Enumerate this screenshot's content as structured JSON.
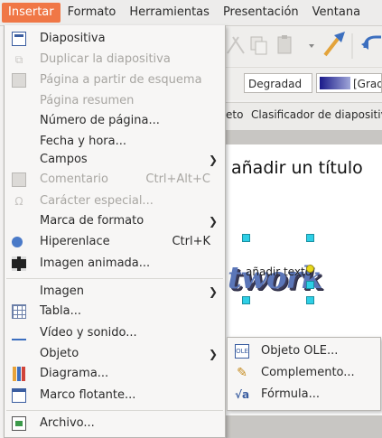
{
  "menubar": [
    "Insertar",
    "Formato",
    "Herramientas",
    "Presentación",
    "Ventana"
  ],
  "toolbar": {
    "fill_style": "Degradad",
    "gradient": "[Gradi"
  },
  "tabs": [
    "eto",
    "Clasificador de diapositivas"
  ],
  "slide": {
    "title": "añadir un título",
    "subtitle": "añadir texto",
    "wordart": "twork"
  },
  "menu_items": [
    {
      "label": "Diapositiva",
      "icon": "slide-icon"
    },
    {
      "label": "Duplicar la diapositiva",
      "icon": "duplicate-slide-icon",
      "disabled": true
    },
    {
      "label": "Página a partir de esquema",
      "icon": "outline-page-icon",
      "disabled": true
    },
    {
      "label": "Página resumen",
      "disabled": true
    },
    {
      "label": "Número de página..."
    },
    {
      "label": "Fecha y hora..."
    },
    {
      "label": "Campos"
    },
    {
      "label": "Comentario",
      "accel": "Ctrl+Alt+C",
      "icon": "comment-icon",
      "disabled": true
    },
    {
      "label": "Carácter especial...",
      "icon": "special-char-icon",
      "disabled": true
    },
    {
      "label": "Marca de formato"
    },
    {
      "label": "Hiperenlace",
      "accel": "Ctrl+K",
      "icon": "hyperlink-icon"
    },
    {
      "label": "Imagen animada...",
      "icon": "animated-image-icon"
    },
    {
      "label": "Imagen"
    },
    {
      "label": "Tabla...",
      "icon": "table-icon"
    },
    {
      "label": "Vídeo y sonido...",
      "icon": "media-icon"
    },
    {
      "label": "Objeto"
    },
    {
      "label": "Diagrama...",
      "icon": "chart-icon"
    },
    {
      "label": "Marco flotante...",
      "icon": "floating-frame-icon"
    },
    {
      "label": "Archivo...",
      "icon": "file-icon"
    }
  ],
  "submenu_items": [
    {
      "label": "Objeto OLE...",
      "icon": "ole-object-icon"
    },
    {
      "label": "Complemento...",
      "icon": "plugin-icon"
    },
    {
      "label": "Fórmula...",
      "icon": "formula-icon"
    }
  ],
  "colors": {
    "accent": "#f07746",
    "handle": "#2ecfe6",
    "wordart": "#5b76b8"
  }
}
